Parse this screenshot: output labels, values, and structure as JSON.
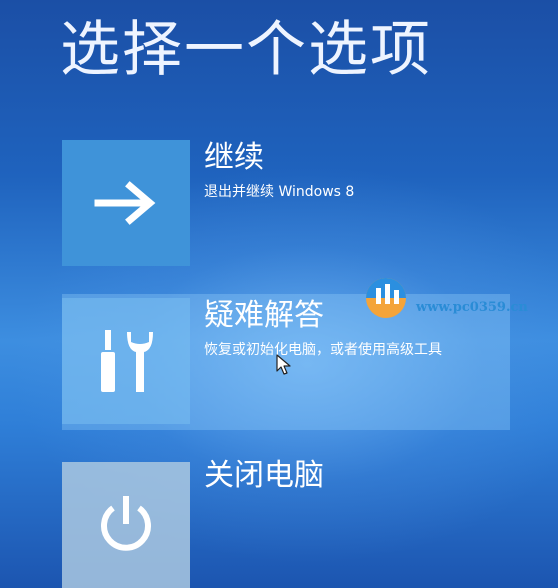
{
  "screen": {
    "title": "选择一个选项"
  },
  "options": [
    {
      "icon": "arrow-right-icon",
      "label": "继续",
      "description": "退出并继续 Windows 8"
    },
    {
      "icon": "tools-icon",
      "label": "疑难解答",
      "description": "恢复或初始化电脑，或者使用高级工具"
    },
    {
      "icon": "power-icon",
      "label": "关闭电脑",
      "description": ""
    }
  ],
  "watermark": {
    "text": "www.pc0359.cn"
  },
  "colors": {
    "background": "#1f63be",
    "tile_accent": "#3f93d9",
    "text": "#ffffff"
  }
}
